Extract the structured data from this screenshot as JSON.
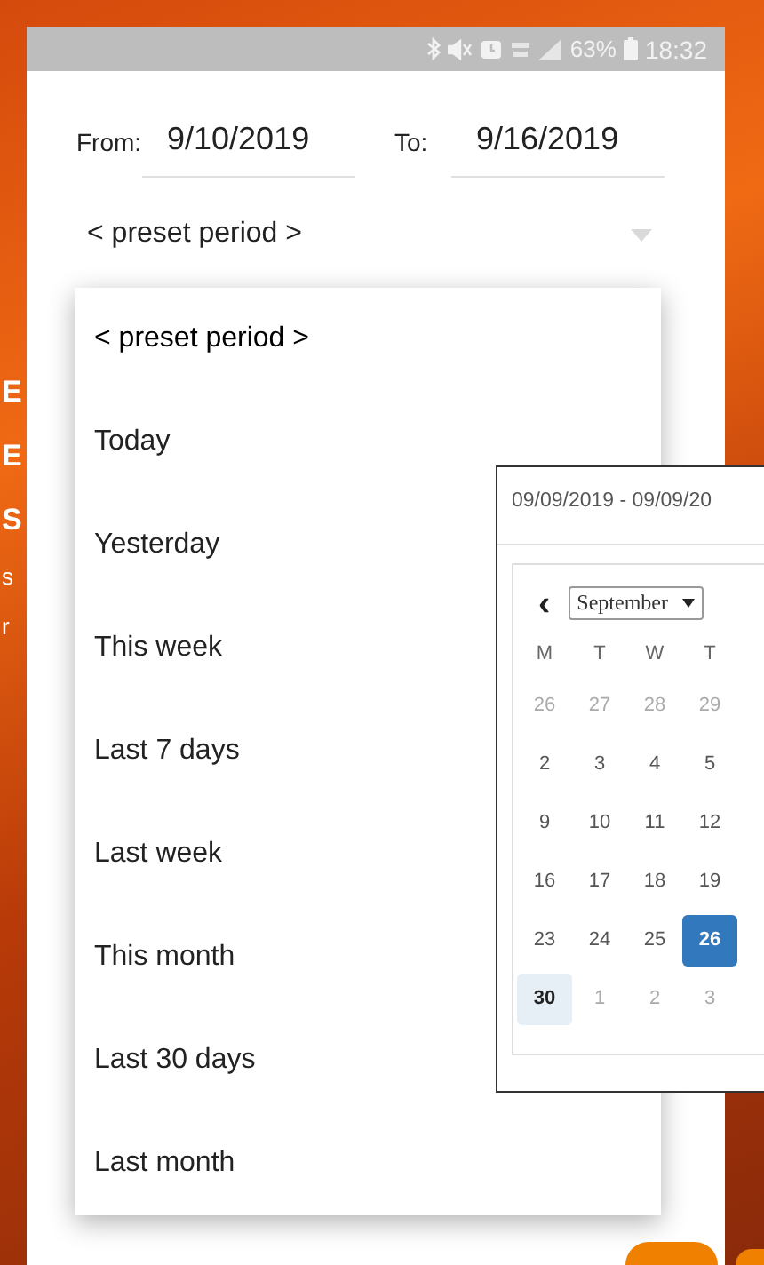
{
  "background_text": [
    {
      "text": "E",
      "kind": "large"
    },
    {
      "text": "E",
      "kind": "large"
    },
    {
      "text": "S",
      "kind": "large"
    },
    {
      "text": "s",
      "kind": "small"
    },
    {
      "text": "r",
      "kind": "small"
    }
  ],
  "status_bar": {
    "battery": "63%",
    "time": "18:32"
  },
  "date_range": {
    "from_label": "From:",
    "from_value": "9/10/2019",
    "to_label": "To:",
    "to_value": "9/16/2019"
  },
  "preset_select": {
    "value": "< preset period >",
    "expanded": true
  },
  "preset_options": [
    {
      "label": "< preset period >",
      "selected": true
    },
    {
      "label": "Today",
      "selected": false
    },
    {
      "label": "Yesterday",
      "selected": false
    },
    {
      "label": "This week",
      "selected": false
    },
    {
      "label": "Last 7 days",
      "selected": false
    },
    {
      "label": "Last week",
      "selected": false
    },
    {
      "label": "This month",
      "selected": false
    },
    {
      "label": "Last 30 days",
      "selected": false
    },
    {
      "label": "Last month",
      "selected": false
    }
  ],
  "calendar_popup": {
    "range_text": "09/09/2019 - 09/09/20",
    "prev": "‹",
    "month": "September",
    "weekdays": [
      "M",
      "T",
      "W",
      "T"
    ],
    "days": [
      {
        "label": "26",
        "muted": true,
        "selected": false,
        "today": false
      },
      {
        "label": "27",
        "muted": true,
        "selected": false,
        "today": false
      },
      {
        "label": "28",
        "muted": true,
        "selected": false,
        "today": false
      },
      {
        "label": "29",
        "muted": true,
        "selected": false,
        "today": false
      },
      {
        "label": "2",
        "muted": false,
        "selected": false,
        "today": false
      },
      {
        "label": "3",
        "muted": false,
        "selected": false,
        "today": false
      },
      {
        "label": "4",
        "muted": false,
        "selected": false,
        "today": false
      },
      {
        "label": "5",
        "muted": false,
        "selected": false,
        "today": false
      },
      {
        "label": "9",
        "muted": false,
        "selected": false,
        "today": false
      },
      {
        "label": "10",
        "muted": false,
        "selected": false,
        "today": false
      },
      {
        "label": "11",
        "muted": false,
        "selected": false,
        "today": false
      },
      {
        "label": "12",
        "muted": false,
        "selected": false,
        "today": false
      },
      {
        "label": "16",
        "muted": false,
        "selected": false,
        "today": false
      },
      {
        "label": "17",
        "muted": false,
        "selected": false,
        "today": false
      },
      {
        "label": "18",
        "muted": false,
        "selected": false,
        "today": false
      },
      {
        "label": "19",
        "muted": false,
        "selected": false,
        "today": false
      },
      {
        "label": "23",
        "muted": false,
        "selected": false,
        "today": false
      },
      {
        "label": "24",
        "muted": false,
        "selected": false,
        "today": false
      },
      {
        "label": "25",
        "muted": false,
        "selected": false,
        "today": false
      },
      {
        "label": "26",
        "muted": false,
        "selected": true,
        "today": false
      },
      {
        "label": "30",
        "muted": false,
        "selected": false,
        "today": true
      },
      {
        "label": "1",
        "muted": true,
        "selected": false,
        "today": false
      },
      {
        "label": "2",
        "muted": true,
        "selected": false,
        "today": false
      },
      {
        "label": "3",
        "muted": true,
        "selected": false,
        "today": false
      }
    ]
  }
}
